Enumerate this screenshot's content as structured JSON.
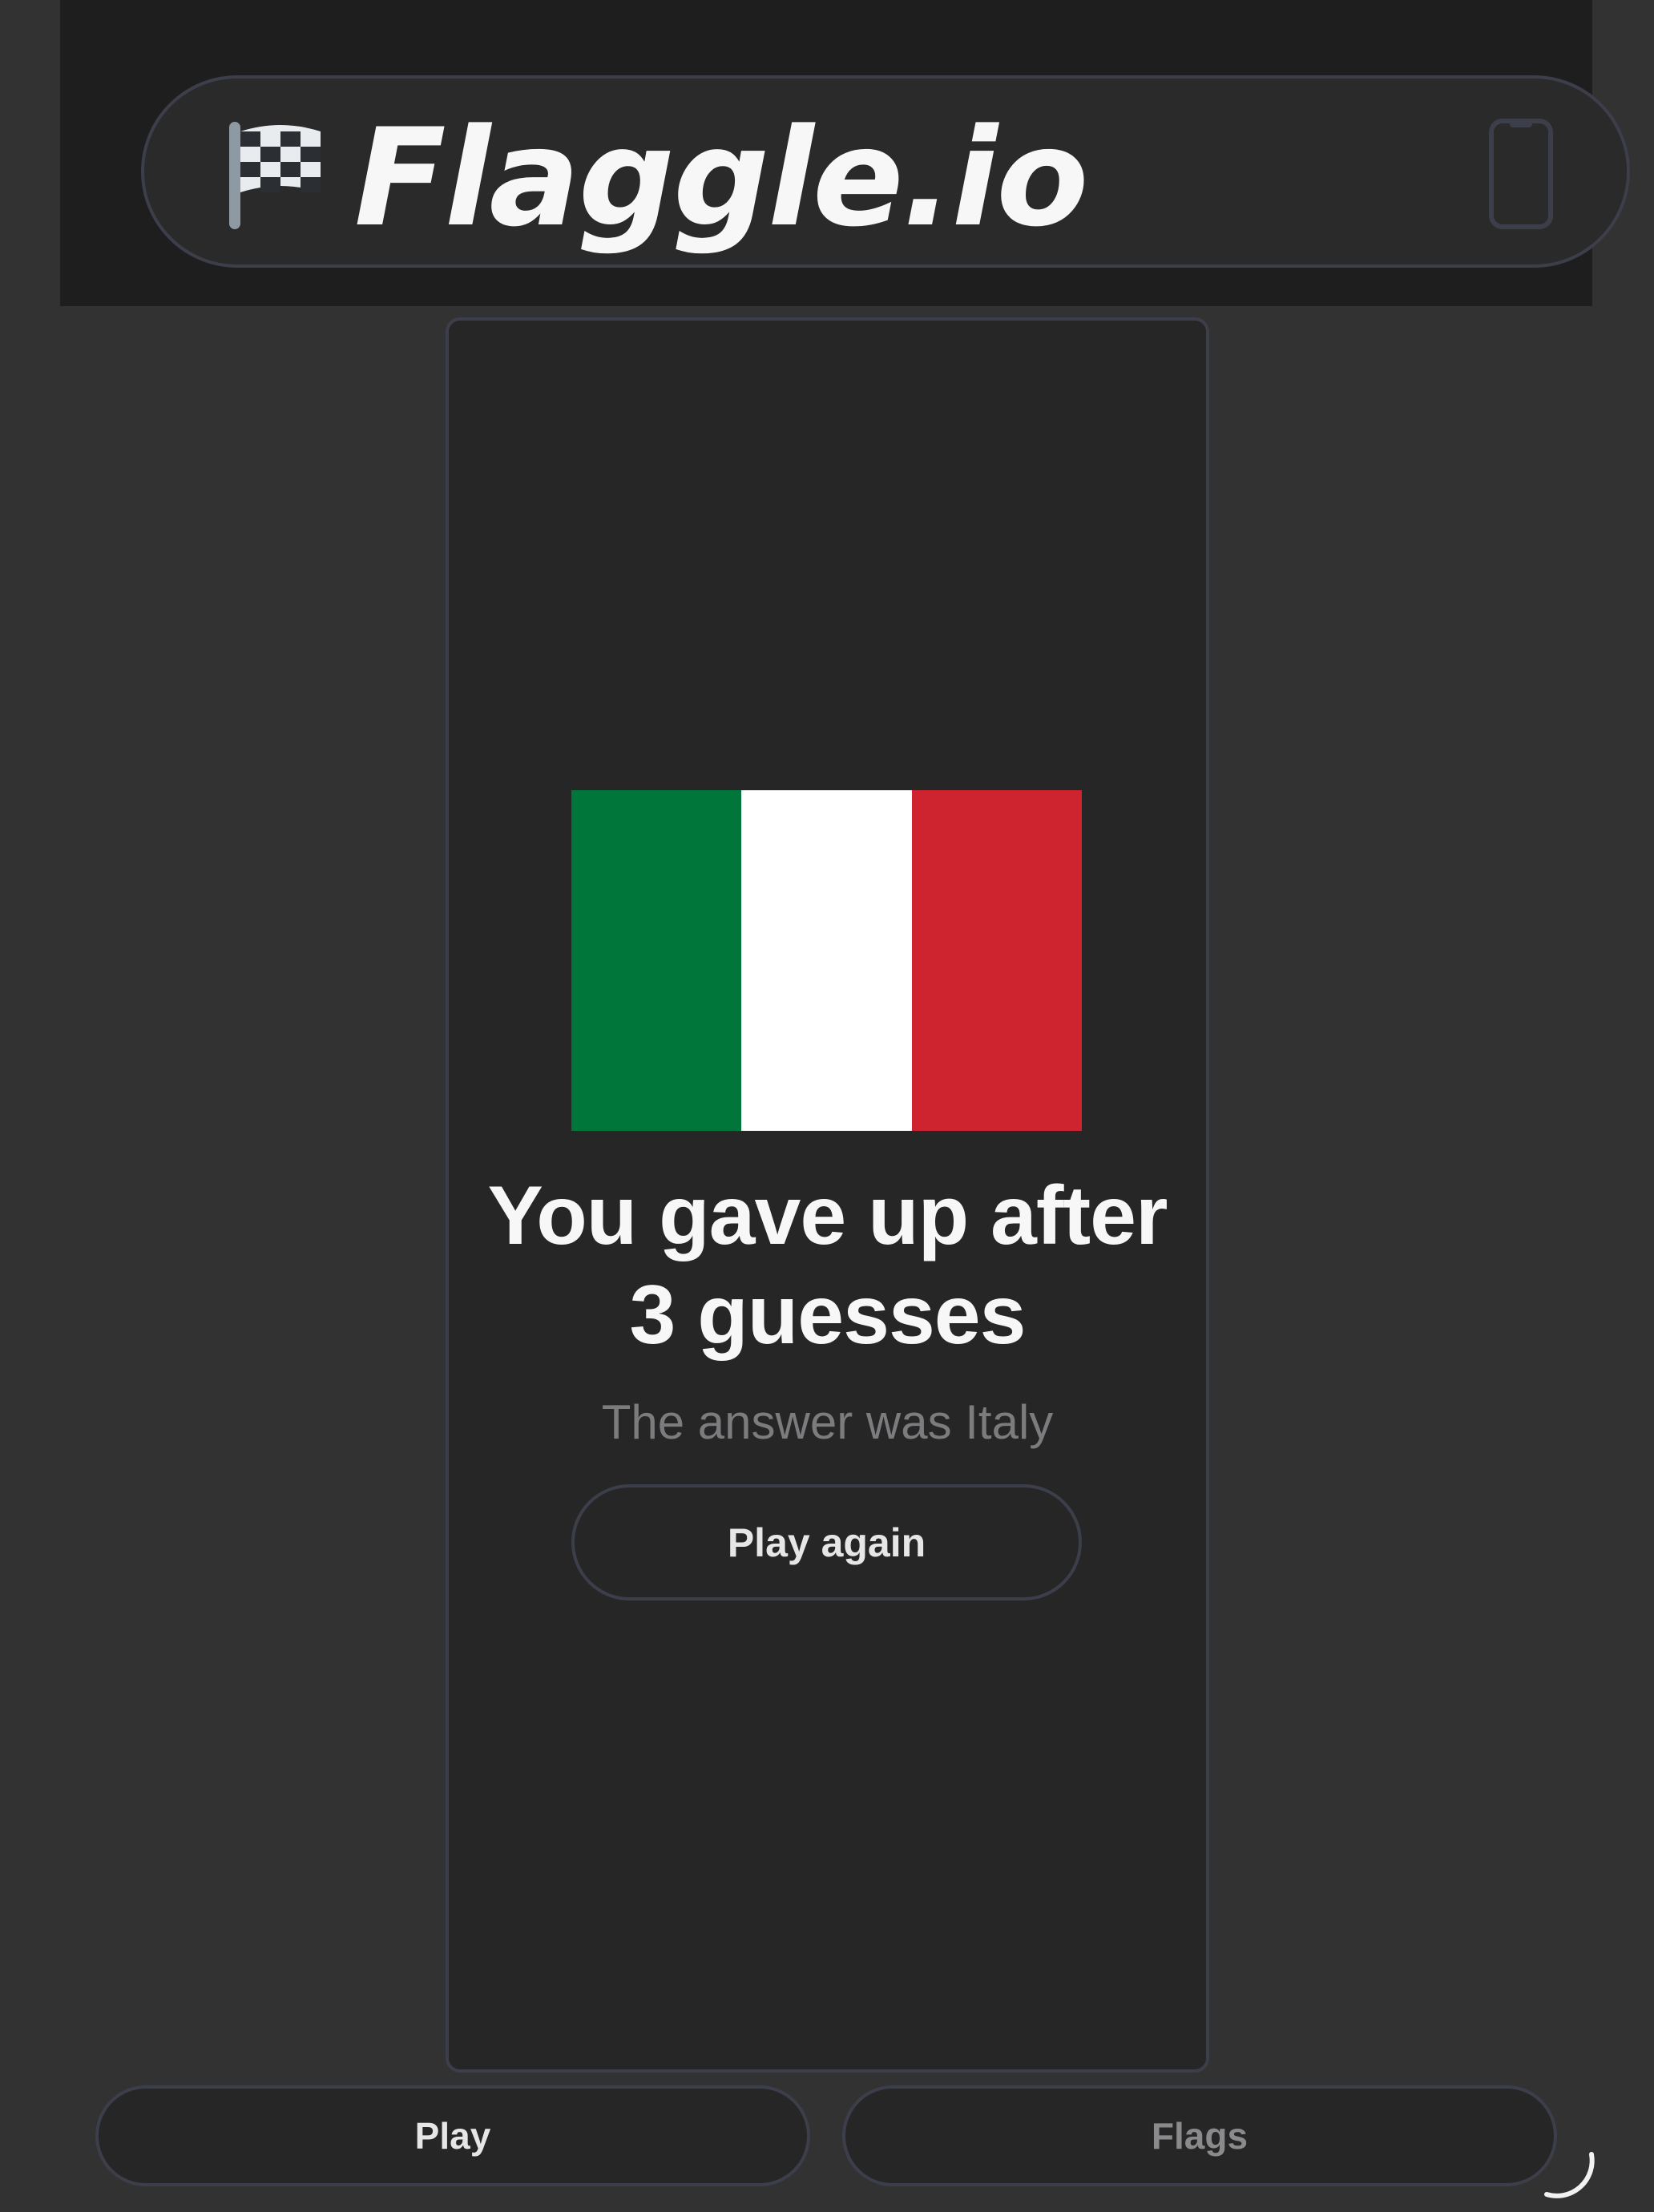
{
  "header": {
    "logo_text": "Flaggle.io",
    "logo_icon": "checkered-flag-icon",
    "device_icon": "phone-icon"
  },
  "result": {
    "flag_colors": [
      "#00763a",
      "#ffffff",
      "#ce2430"
    ],
    "headline": "You gave up after 3 guesses",
    "answer": "The answer was Italy",
    "play_again_label": "Play again"
  },
  "nav": {
    "play_label": "Play",
    "flags_label": "Flags"
  },
  "colors": {
    "background": "#323232",
    "topbar": "#1e1e1f",
    "card": "#262627",
    "border": "#3c3f4a",
    "text": "#f7f7f7",
    "muted": "#7c7c7f"
  }
}
